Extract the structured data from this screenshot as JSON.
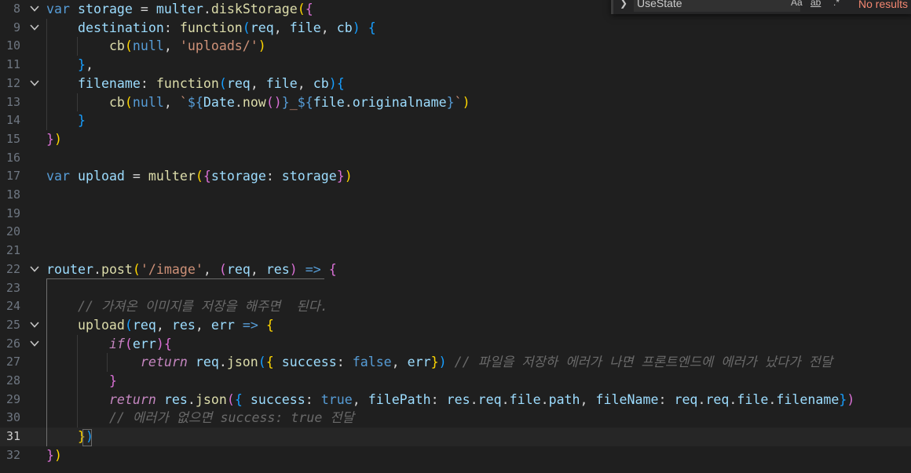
{
  "find_widget": {
    "query": "UseState",
    "match_case_label": "Aa",
    "whole_word_label": "ab",
    "status": "No results"
  },
  "editor": {
    "current_line": "31",
    "lines": [
      {
        "num": "8",
        "fold": true,
        "tokens": [
          [
            "kw",
            "var"
          ],
          [
            "punc",
            " "
          ],
          [
            "var",
            "storage"
          ],
          [
            "punc",
            " = "
          ],
          [
            "var",
            "multer"
          ],
          [
            "punc",
            "."
          ],
          [
            "fn",
            "diskStorage"
          ],
          [
            "b1",
            "("
          ],
          [
            "b2",
            "{"
          ]
        ]
      },
      {
        "num": "9",
        "fold": true,
        "tokens": [
          [
            "punc",
            "    "
          ],
          [
            "prop",
            "destination"
          ],
          [
            "punc",
            ": "
          ],
          [
            "fn",
            "function"
          ],
          [
            "b3",
            "("
          ],
          [
            "var",
            "req"
          ],
          [
            "punc",
            ", "
          ],
          [
            "var",
            "file"
          ],
          [
            "punc",
            ", "
          ],
          [
            "var",
            "cb"
          ],
          [
            "b3",
            ")"
          ],
          [
            "punc",
            " "
          ],
          [
            "b3",
            "{"
          ]
        ]
      },
      {
        "num": "10",
        "fold": false,
        "tokens": [
          [
            "punc",
            "        "
          ],
          [
            "fn",
            "cb"
          ],
          [
            "b1",
            "("
          ],
          [
            "kw",
            "null"
          ],
          [
            "punc",
            ", "
          ],
          [
            "str",
            "'uploads/'"
          ],
          [
            "b1",
            ")"
          ]
        ]
      },
      {
        "num": "11",
        "fold": false,
        "tokens": [
          [
            "punc",
            "    "
          ],
          [
            "b3",
            "}"
          ],
          [
            "punc",
            ","
          ]
        ]
      },
      {
        "num": "12",
        "fold": true,
        "tokens": [
          [
            "punc",
            "    "
          ],
          [
            "prop",
            "filename"
          ],
          [
            "punc",
            ": "
          ],
          [
            "fn",
            "function"
          ],
          [
            "b3",
            "("
          ],
          [
            "var",
            "req"
          ],
          [
            "punc",
            ", "
          ],
          [
            "var",
            "file"
          ],
          [
            "punc",
            ", "
          ],
          [
            "var",
            "cb"
          ],
          [
            "b3",
            ")"
          ],
          [
            "b3",
            "{"
          ]
        ]
      },
      {
        "num": "13",
        "fold": false,
        "tokens": [
          [
            "punc",
            "        "
          ],
          [
            "fn",
            "cb"
          ],
          [
            "b1",
            "("
          ],
          [
            "kw",
            "null"
          ],
          [
            "punc",
            ", "
          ],
          [
            "str",
            "`"
          ],
          [
            "kw",
            "${"
          ],
          [
            "var",
            "Date"
          ],
          [
            "punc",
            "."
          ],
          [
            "fn",
            "now"
          ],
          [
            "b2",
            "()"
          ],
          [
            "kw",
            "}"
          ],
          [
            "str",
            "_"
          ],
          [
            "kw",
            "${"
          ],
          [
            "var",
            "file"
          ],
          [
            "punc",
            "."
          ],
          [
            "prop",
            "originalname"
          ],
          [
            "kw",
            "}"
          ],
          [
            "str",
            "`"
          ],
          [
            "b1",
            ")"
          ]
        ]
      },
      {
        "num": "14",
        "fold": false,
        "tokens": [
          [
            "punc",
            "    "
          ],
          [
            "b3",
            "}"
          ]
        ]
      },
      {
        "num": "15",
        "fold": false,
        "tokens": [
          [
            "b2",
            "}"
          ],
          [
            "b1",
            ")"
          ]
        ]
      },
      {
        "num": "16",
        "fold": false,
        "tokens": []
      },
      {
        "num": "17",
        "fold": false,
        "tokens": [
          [
            "kw",
            "var"
          ],
          [
            "punc",
            " "
          ],
          [
            "var",
            "upload"
          ],
          [
            "punc",
            " = "
          ],
          [
            "fn",
            "multer"
          ],
          [
            "b1",
            "("
          ],
          [
            "b2",
            "{"
          ],
          [
            "prop",
            "storage"
          ],
          [
            "punc",
            ": "
          ],
          [
            "var",
            "storage"
          ],
          [
            "b2",
            "}"
          ],
          [
            "b1",
            ")"
          ]
        ]
      },
      {
        "num": "18",
        "fold": false,
        "tokens": []
      },
      {
        "num": "19",
        "fold": false,
        "tokens": []
      },
      {
        "num": "20",
        "fold": false,
        "tokens": []
      },
      {
        "num": "21",
        "fold": false,
        "tokens": []
      },
      {
        "num": "22",
        "fold": true,
        "tokens": [
          [
            "var",
            "router"
          ],
          [
            "punc",
            "."
          ],
          [
            "fn",
            "post"
          ],
          [
            "b1",
            "("
          ],
          [
            "str",
            "'/image'"
          ],
          [
            "punc",
            ", "
          ],
          [
            "b2",
            "("
          ],
          [
            "var",
            "req"
          ],
          [
            "punc",
            ", "
          ],
          [
            "var",
            "res"
          ],
          [
            "b2",
            ")"
          ],
          [
            "punc",
            " "
          ],
          [
            "kw",
            "=>"
          ],
          [
            "punc",
            " "
          ],
          [
            "b2",
            "{"
          ]
        ]
      },
      {
        "num": "23",
        "fold": false,
        "tokens": []
      },
      {
        "num": "24",
        "fold": false,
        "tokens": [
          [
            "punc",
            "    "
          ],
          [
            "cm",
            "// 가져온 이미지를 저장을 해주면  된다."
          ]
        ]
      },
      {
        "num": "25",
        "fold": true,
        "tokens": [
          [
            "punc",
            "    "
          ],
          [
            "fn",
            "upload"
          ],
          [
            "b3",
            "("
          ],
          [
            "var",
            "req"
          ],
          [
            "punc",
            ", "
          ],
          [
            "var",
            "res"
          ],
          [
            "punc",
            ", "
          ],
          [
            "var",
            "err"
          ],
          [
            "punc",
            " "
          ],
          [
            "kw",
            "=>"
          ],
          [
            "punc",
            " "
          ],
          [
            "b1",
            "{"
          ]
        ]
      },
      {
        "num": "26",
        "fold": true,
        "tokens": [
          [
            "punc",
            "        "
          ],
          [
            "ctl",
            "if"
          ],
          [
            "b2",
            "("
          ],
          [
            "var",
            "err"
          ],
          [
            "b2",
            ")"
          ],
          [
            "b2",
            "{"
          ]
        ]
      },
      {
        "num": "27",
        "fold": false,
        "tokens": [
          [
            "punc",
            "            "
          ],
          [
            "ctl",
            "return"
          ],
          [
            "punc",
            " "
          ],
          [
            "var",
            "req"
          ],
          [
            "punc",
            "."
          ],
          [
            "fn",
            "json"
          ],
          [
            "b3",
            "("
          ],
          [
            "b1",
            "{"
          ],
          [
            "punc",
            " "
          ],
          [
            "prop",
            "success"
          ],
          [
            "punc",
            ": "
          ],
          [
            "bool",
            "false"
          ],
          [
            "punc",
            ", "
          ],
          [
            "var",
            "err"
          ],
          [
            "b1",
            "}"
          ],
          [
            "b3",
            ")"
          ],
          [
            "punc",
            " "
          ],
          [
            "cm",
            "// 파일을 저장하 에러가 나면 프론트엔드에 에러가 났다가 전달"
          ]
        ]
      },
      {
        "num": "28",
        "fold": false,
        "tokens": [
          [
            "punc",
            "        "
          ],
          [
            "b2",
            "}"
          ]
        ]
      },
      {
        "num": "29",
        "fold": false,
        "tokens": [
          [
            "punc",
            "        "
          ],
          [
            "ctl",
            "return"
          ],
          [
            "punc",
            " "
          ],
          [
            "var",
            "res"
          ],
          [
            "punc",
            "."
          ],
          [
            "fn",
            "json"
          ],
          [
            "b2",
            "("
          ],
          [
            "b3",
            "{"
          ],
          [
            "punc",
            " "
          ],
          [
            "prop",
            "success"
          ],
          [
            "punc",
            ": "
          ],
          [
            "bool",
            "true"
          ],
          [
            "punc",
            ", "
          ],
          [
            "prop",
            "filePath"
          ],
          [
            "punc",
            ": "
          ],
          [
            "var",
            "res"
          ],
          [
            "punc",
            "."
          ],
          [
            "var",
            "req"
          ],
          [
            "punc",
            "."
          ],
          [
            "var",
            "file"
          ],
          [
            "punc",
            "."
          ],
          [
            "prop",
            "path"
          ],
          [
            "punc",
            ", "
          ],
          [
            "prop",
            "fileName"
          ],
          [
            "punc",
            ": "
          ],
          [
            "var",
            "req"
          ],
          [
            "punc",
            "."
          ],
          [
            "var",
            "req"
          ],
          [
            "punc",
            "."
          ],
          [
            "var",
            "file"
          ],
          [
            "punc",
            "."
          ],
          [
            "prop",
            "filename"
          ],
          [
            "b3",
            "}"
          ],
          [
            "b2",
            ")"
          ]
        ]
      },
      {
        "num": "30",
        "fold": false,
        "tokens": [
          [
            "punc",
            "        "
          ],
          [
            "cm",
            "// 에러가 없으면 success: true 전달"
          ]
        ]
      },
      {
        "num": "31",
        "fold": false,
        "tokens": [
          [
            "punc",
            "    "
          ],
          [
            "b1",
            "}"
          ],
          [
            "b3",
            ")"
          ]
        ]
      },
      {
        "num": "32",
        "fold": false,
        "tokens": [
          [
            "b2",
            "}"
          ],
          [
            "b1",
            ")"
          ]
        ]
      }
    ]
  }
}
